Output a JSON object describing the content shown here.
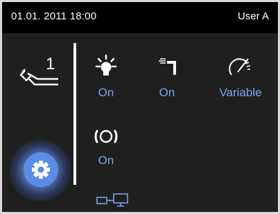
{
  "header": {
    "datetime": "01.01. 2011 18:00",
    "user": "User A"
  },
  "instrument": {
    "number": "1"
  },
  "features": {
    "light": {
      "icon": "light-bulb-icon",
      "label": "On"
    },
    "spray": {
      "icon": "water-spray-icon",
      "label": "On"
    },
    "speed": {
      "icon": "speed-gauge-icon",
      "label": "Variable"
    },
    "ring": {
      "icon": "ring-light-icon",
      "label": "On"
    }
  },
  "colors": {
    "accent_label": "#7aa6f0",
    "gear_button": "#5b8ce8",
    "topbar": "#000000",
    "background": "#1f1f1f"
  }
}
